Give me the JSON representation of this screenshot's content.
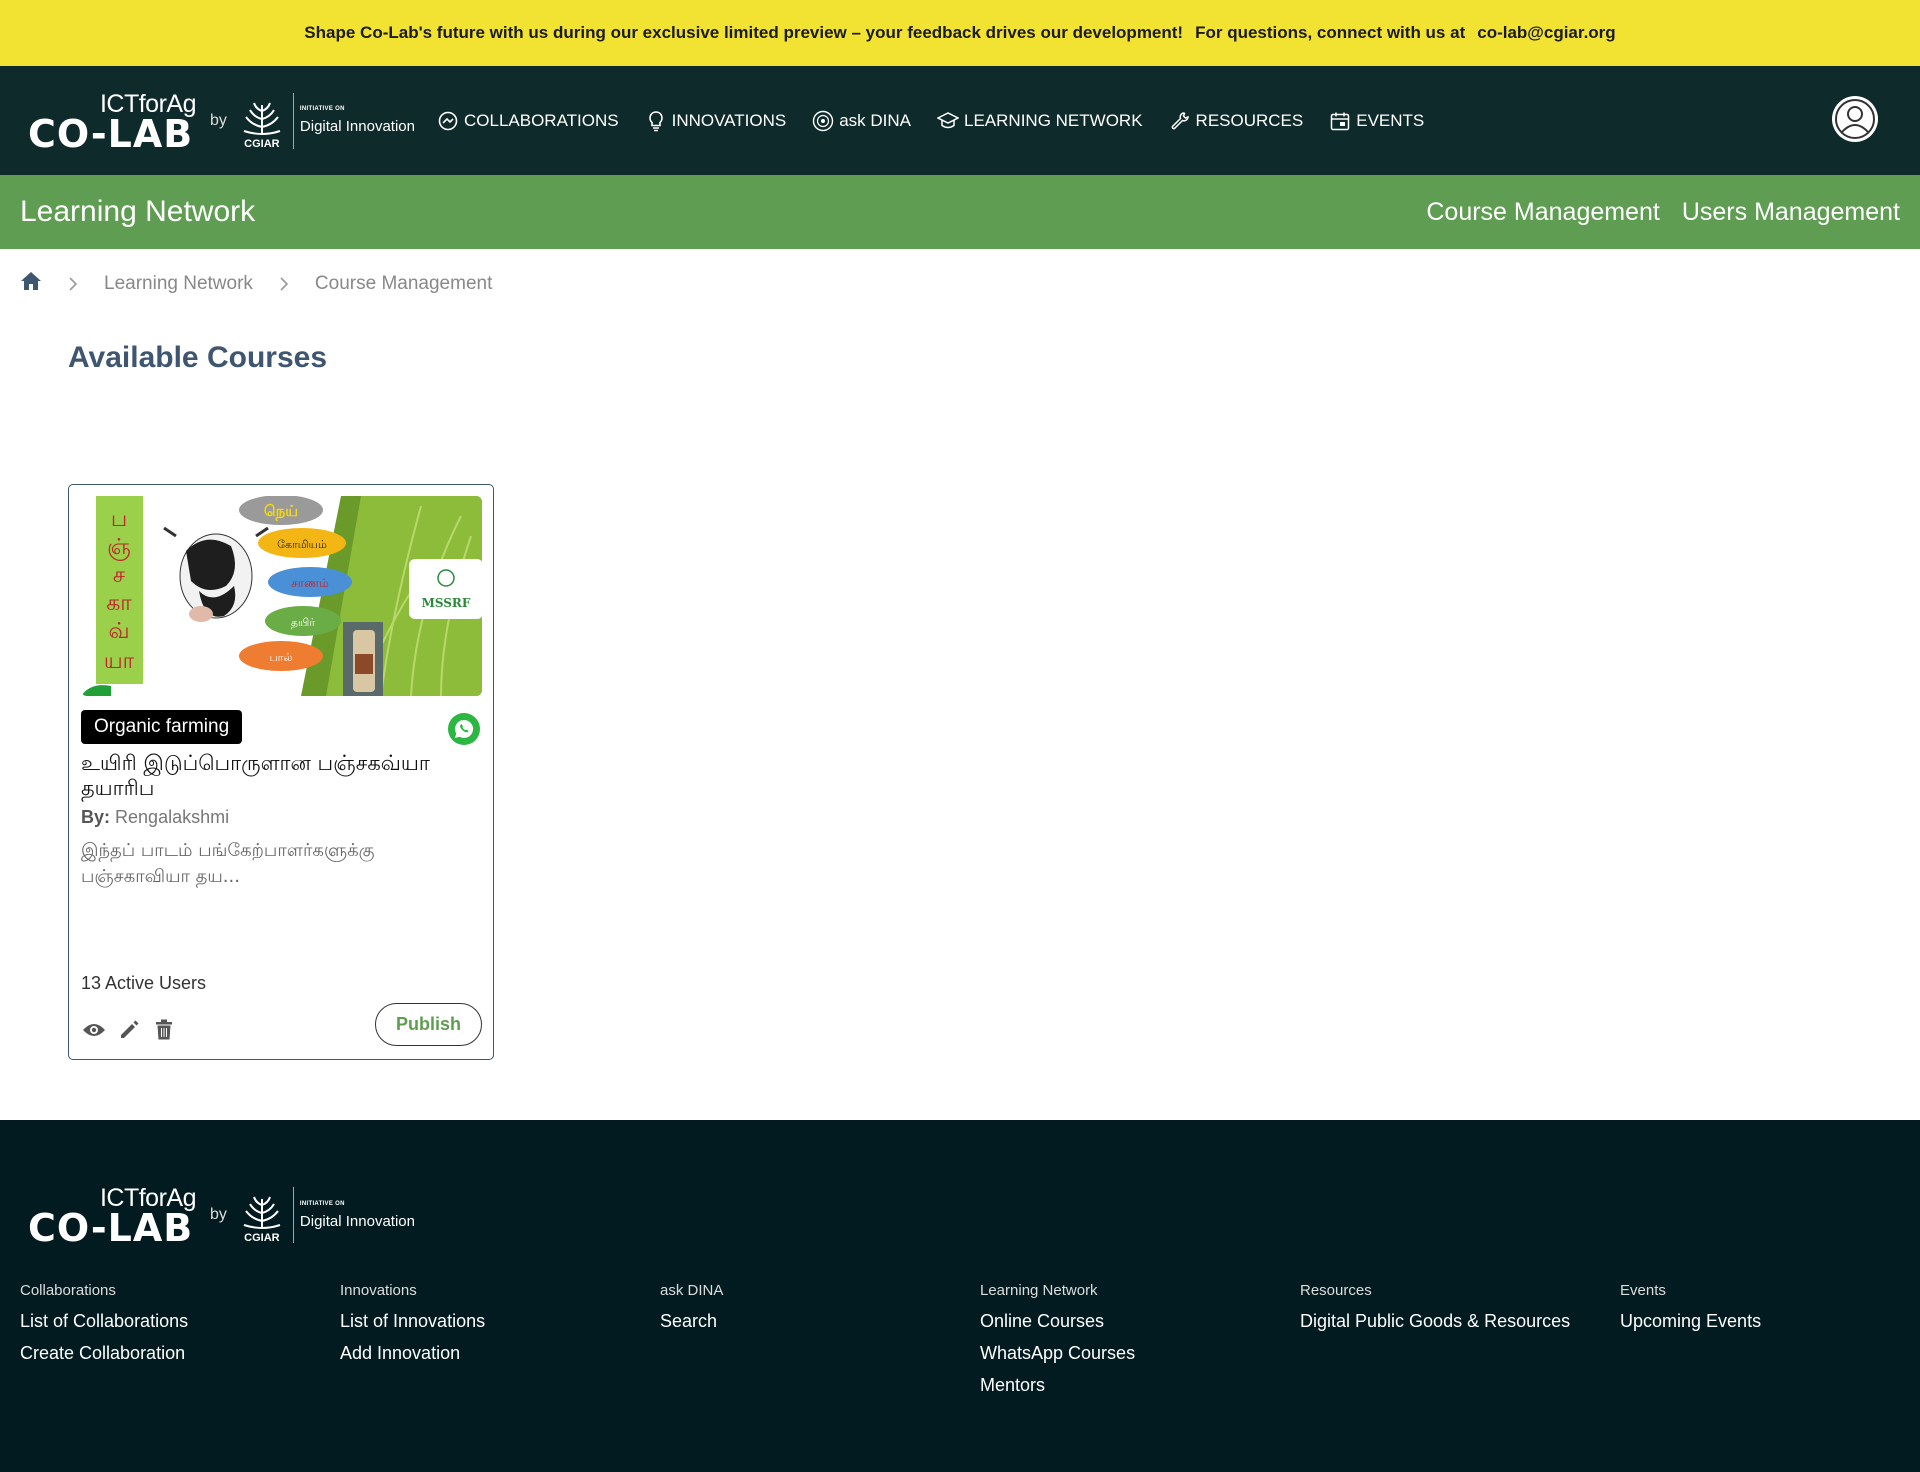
{
  "banner": {
    "message": "Shape Co-Lab's future with us during our exclusive limited preview – your feedback drives our development!",
    "contact_prefix": "For questions, connect with us at",
    "email": "co-lab@cgiar.org"
  },
  "logo": {
    "sup": "ICTforAg",
    "main": "CO-LAB",
    "by": "by",
    "cgiar": "CGIAR",
    "initiative_small": "INITIATIVE ON",
    "initiative": "Digital Innovation"
  },
  "nav": {
    "items": [
      {
        "label": "COLLABORATIONS",
        "icon": "handshake-icon"
      },
      {
        "label": "INNOVATIONS",
        "icon": "lightbulb-icon"
      },
      {
        "label": "ask DINA",
        "icon": "dina-icon"
      },
      {
        "label": "LEARNING NETWORK",
        "icon": "graduation-cap-icon"
      },
      {
        "label": "RESOURCES",
        "icon": "wrench-icon"
      },
      {
        "label": "EVENTS",
        "icon": "calendar-icon"
      }
    ]
  },
  "section_bar": {
    "title": "Learning Network",
    "tabs": [
      "Course Management",
      "Users Management"
    ]
  },
  "breadcrumb": [
    "Learning Network",
    "Course Management"
  ],
  "page": {
    "title": "Available Courses"
  },
  "course": {
    "image_labels": {
      "vertical": [
        "ப",
        "ஞ்",
        "ச",
        "கா",
        "வ்",
        "யா"
      ],
      "bubbles": [
        "நெய்",
        "கோமியம்",
        "சாணம்",
        "தயிர்",
        "பால்"
      ],
      "org": "MSSRF"
    },
    "tag": "Organic farming",
    "title": "உயிரி இடுப்பொருளான பஞ்சகவ்யா தயாரிப",
    "by_label": "By:",
    "author": "Rengalakshmi",
    "description": "இந்தப் பாடம் பங்கேற்பாளர்களுக்கு பஞ்சகாவியா தய...",
    "active_users": "13 Active Users",
    "publish_label": "Publish"
  },
  "footer": {
    "columns": [
      {
        "heading": "Collaborations",
        "links": [
          "List of Collaborations",
          "Create Collaboration"
        ]
      },
      {
        "heading": "Innovations",
        "links": [
          "List of Innovations",
          "Add Innovation"
        ]
      },
      {
        "heading": "ask DINA",
        "links": [
          "Search"
        ]
      },
      {
        "heading": "Learning Network",
        "links": [
          "Online Courses",
          "WhatsApp Courses",
          "Mentors"
        ]
      },
      {
        "heading": "Resources",
        "links": [
          "Digital Public Goods & Resources"
        ]
      },
      {
        "heading": "Events",
        "links": [
          "Upcoming Events"
        ]
      }
    ]
  },
  "colors": {
    "banner": "#f2e332",
    "nav_bg": "#0f2a2a",
    "section_green": "#5f9d52",
    "heading_slate": "#3f5670",
    "footer_bg": "#021b20",
    "whatsapp": "#2bb741"
  }
}
